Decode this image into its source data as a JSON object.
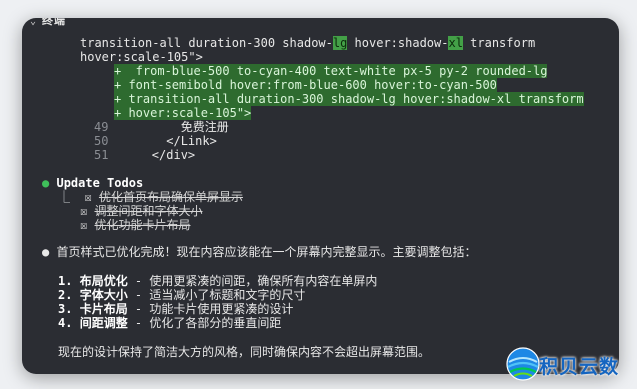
{
  "panel": {
    "chevron": "⌄",
    "title": "终端"
  },
  "code_lines": [
    {
      "pre": "transition-all duration-300 shadow-",
      "hl1": "lg",
      "mid": " hover:shadow-",
      "hl2": "xl",
      "post": " transform"
    },
    {
      "text": "hover:scale-105\">"
    }
  ],
  "added_lines": [
    "+  from-blue-500 to-cyan-400 text-white px-5 py-2 rounded-lg",
    "+ font-semibold hover:from-blue-600 hover:to-cyan-500",
    "+ transition-all duration-300 shadow-lg hover:shadow-xl transform",
    "+ hover:scale-105\">"
  ],
  "numbered_lines": [
    {
      "num": "49",
      "code": "          免费注册"
    },
    {
      "num": "50",
      "code": "        </Link>"
    },
    {
      "num": "51",
      "code": "      </div>"
    }
  ],
  "todos": {
    "bullet": "●",
    "title": "Update Todos",
    "branch": "⎿",
    "checkbox": "☒",
    "items": [
      "优化首页布局确保单屏显示",
      "调整间距和字体大小",
      "优化功能卡片布局"
    ]
  },
  "summary": {
    "bullet": "●",
    "intro": "首页样式已优化完成！现在内容应该能在一个屏幕内完整显示。主要调整包括：",
    "points": [
      {
        "num": "1.",
        "title": "布局优化",
        "desc": " - 使用更紧凑的间距，确保所有内容在单屏内"
      },
      {
        "num": "2.",
        "title": "字体大小",
        "desc": " - 适当减小了标题和文字的尺寸"
      },
      {
        "num": "3.",
        "title": "卡片布局",
        "desc": " - 功能卡片使用更紧凑的设计"
      },
      {
        "num": "4.",
        "title": "间距调整",
        "desc": " - 优化了各部分的垂直间距"
      }
    ],
    "closing": "现在的设计保持了简洁大方的风格，同时确保内容不会超出屏幕范围。"
  },
  "watermark": {
    "text": "积贝云数",
    "icon": "globe-logo"
  },
  "colors": {
    "terminal_bg": "#2b2d33",
    "added_bg": "#2e6b2f",
    "accent_green": "#3fbf5a",
    "brand_blue": "#1565c0"
  }
}
